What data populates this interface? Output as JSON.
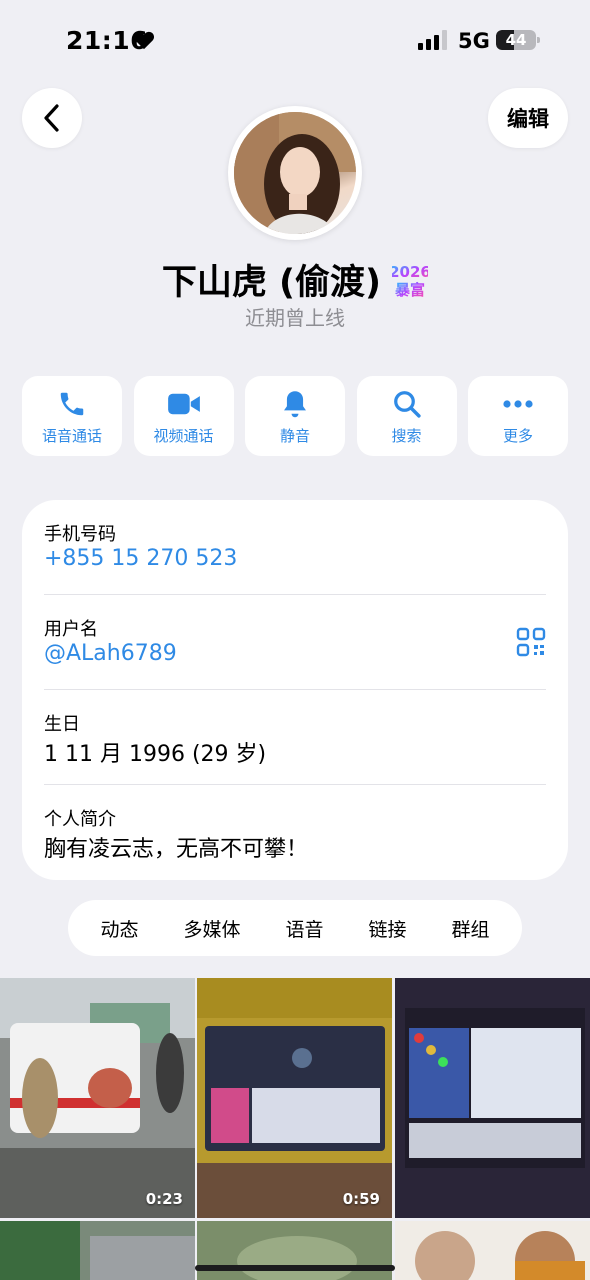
{
  "status_bar": {
    "time": "21:16",
    "network": "5G",
    "battery_level": "44",
    "battery_fraction": 0.44
  },
  "header": {
    "edit_label": "编辑"
  },
  "profile": {
    "name": "下山虎 (偷渡)",
    "badge_year": "2026",
    "badge_text": "暴富",
    "status": "近期曾上线"
  },
  "actions": [
    {
      "label": "语音通话",
      "icon": "phone-icon"
    },
    {
      "label": "视频通话",
      "icon": "video-icon"
    },
    {
      "label": "静音",
      "icon": "bell-icon"
    },
    {
      "label": "搜索",
      "icon": "search-icon"
    },
    {
      "label": "更多",
      "icon": "more-icon"
    }
  ],
  "info": {
    "phone_label": "手机号码",
    "phone_value": "+855 15 270 523",
    "username_label": "用户名",
    "username_value": "@ALah6789",
    "birthday_label": "生日",
    "birthday_value": "1 11 月 1996 (29 岁)",
    "bio_label": "个人简介",
    "bio_value": "胸有凌云志，无高不可攀！"
  },
  "tabs": [
    "动态",
    "多媒体",
    "语音",
    "链接",
    "群组"
  ],
  "media": [
    {
      "duration": "0:23"
    },
    {
      "duration": "0:59"
    },
    {
      "duration": ""
    }
  ],
  "colors": {
    "accent": "#2f8ae5",
    "background": "#efeff4",
    "card": "#ffffff",
    "secondary_text": "#8e8e93"
  }
}
